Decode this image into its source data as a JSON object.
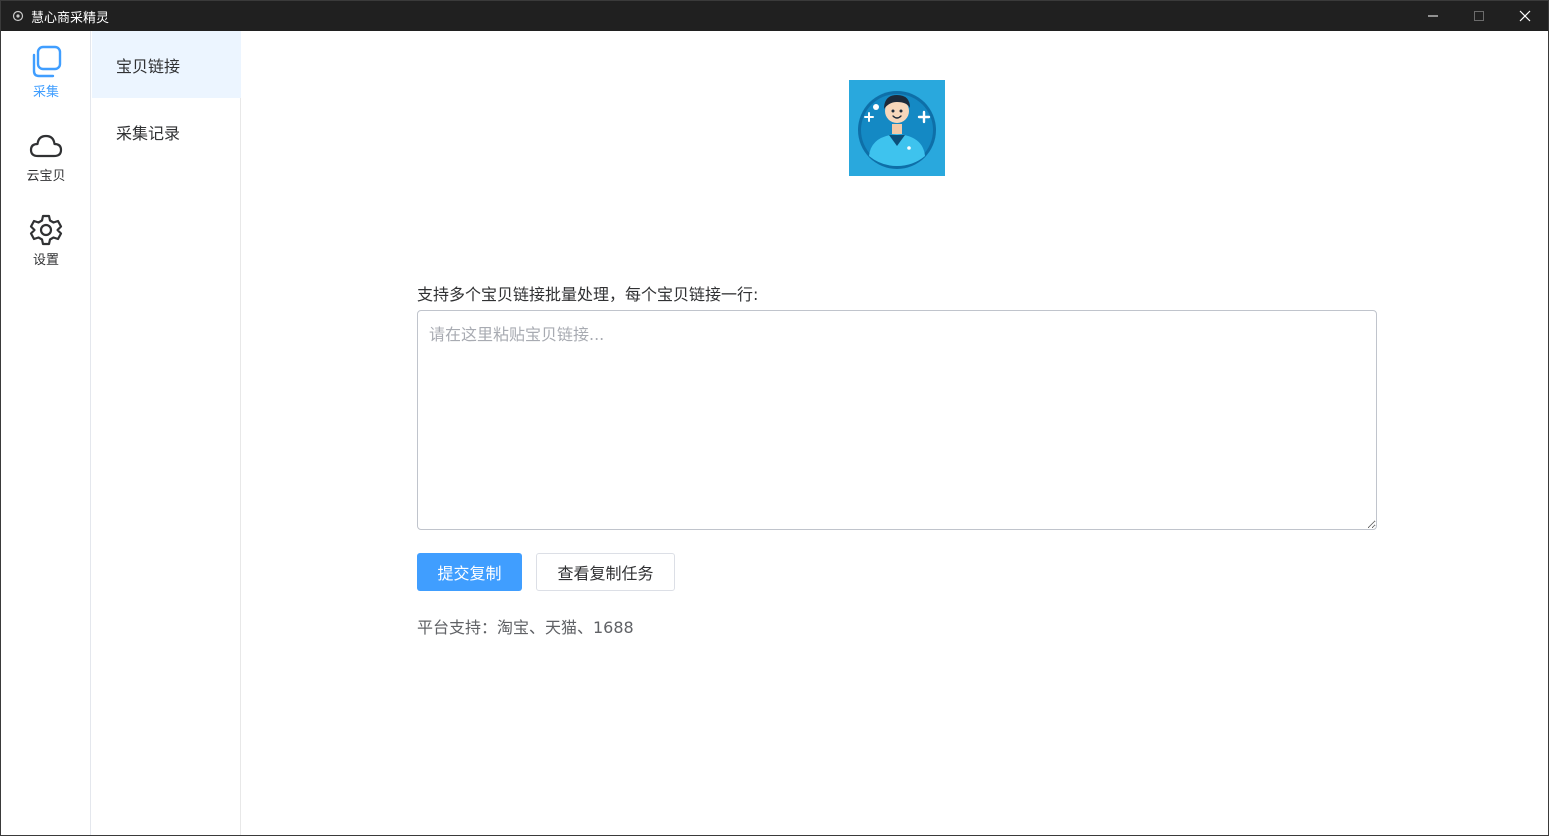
{
  "window": {
    "title": "慧心商采精灵"
  },
  "nav_rail": {
    "items": [
      {
        "label": "采集",
        "icon": "copy-icon",
        "active": true
      },
      {
        "label": "云宝贝",
        "icon": "cloud-icon",
        "active": false
      },
      {
        "label": "设置",
        "icon": "gear-icon",
        "active": false
      }
    ]
  },
  "submenu": {
    "items": [
      {
        "label": "宝贝链接",
        "active": true
      },
      {
        "label": "采集记录",
        "active": false
      }
    ]
  },
  "main": {
    "avatar_icon": "doctor-avatar-icon",
    "intro_text": "支持多个宝贝链接批量处理，每个宝贝链接一行:",
    "links_input": {
      "value": "",
      "placeholder": "请在这里粘贴宝贝链接..."
    },
    "submit_label": "提交复制",
    "view_tasks_label": "查看复制任务",
    "platforms_text": "平台支持：淘宝、天猫、1688"
  },
  "colors": {
    "accent": "#409eff",
    "titlebar": "#202020",
    "active_bg": "#ecf5ff",
    "avatar_bg": "#29a8dd"
  }
}
